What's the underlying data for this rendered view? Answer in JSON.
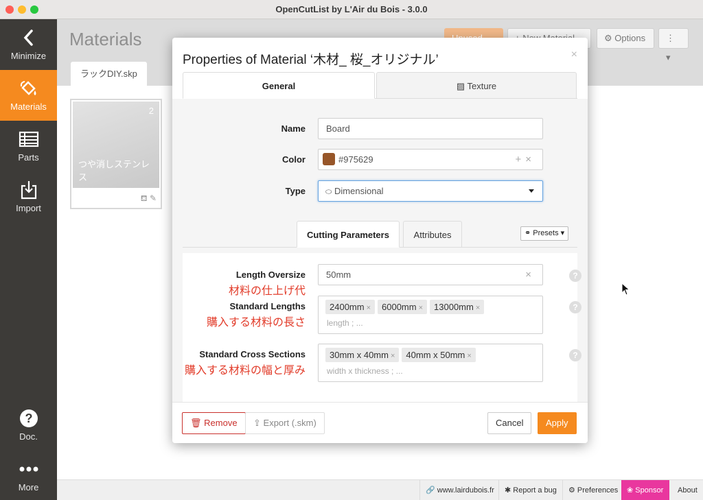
{
  "window": {
    "title": "OpenCutList by L'Air du Bois - 3.0.0"
  },
  "sidebar": {
    "items": [
      {
        "label": "Minimize",
        "icon": "chevron-left-icon"
      },
      {
        "label": "Materials",
        "icon": "paint-bucket-icon",
        "active": true
      },
      {
        "label": "Parts",
        "icon": "list-icon"
      },
      {
        "label": "Import",
        "icon": "import-icon"
      },
      {
        "label": "Doc.",
        "icon": "question-icon"
      },
      {
        "label": "More",
        "icon": "more-dots-icon"
      }
    ]
  },
  "header": {
    "title": "Materials",
    "buttons": {
      "btn1": "Unused",
      "btn2": "+ New Material",
      "options": "Options"
    }
  },
  "file_tab": "ラックDIY.skp",
  "material_card": {
    "name": "つや消しステンレス",
    "badge": "2"
  },
  "dialog": {
    "title": "Properties of Material ‘木材_ 桜_オリジナル’",
    "close": "×",
    "tabs": {
      "general": "General",
      "texture": "Texture"
    },
    "fields": {
      "name_label": "Name",
      "name_value": "Board",
      "color_label": "Color",
      "color_value": "#975629",
      "type_label": "Type",
      "type_value": "Dimensional"
    },
    "subtabs": {
      "cutting": "Cutting Parameters",
      "attributes": "Attributes"
    },
    "presets": "Presets",
    "cutting": {
      "length_oversize_label": "Length Oversize",
      "length_oversize_value": "50mm",
      "length_oversize_note": "材料の仕上げ代",
      "std_lengths_label": "Standard Lengths",
      "std_lengths_note": "購入する材料の長さ",
      "std_lengths": [
        "2400mm",
        "6000mm",
        "13000mm"
      ],
      "std_lengths_placeholder": "length ; ...",
      "std_sections_label": "Standard Cross Sections",
      "std_sections_note": "購入する材料の幅と厚み",
      "std_sections": [
        "30mm x 40mm",
        "40mm x 50mm"
      ],
      "std_sections_placeholder": "width x thickness ; ..."
    },
    "footer": {
      "remove": "Remove",
      "export": "Export (.skm)",
      "cancel": "Cancel",
      "apply": "Apply"
    }
  },
  "statusbar": {
    "website": "www.lairdubois.fr",
    "report": "Report a bug",
    "preferences": "Preferences",
    "sponsor": "Sponsor",
    "about": "About"
  },
  "colors": {
    "accent": "#f58a1f",
    "sidebar": "#3d3b38",
    "sponsor": "#e9379e",
    "danger": "#c9302c",
    "swatch": "#975629"
  }
}
